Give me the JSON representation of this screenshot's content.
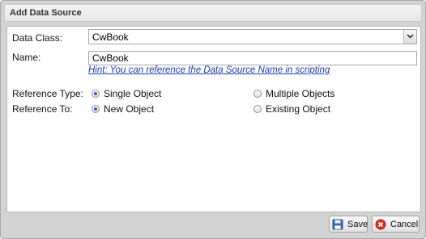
{
  "dialog": {
    "title": "Add Data Source",
    "data_class": {
      "label": "Data Class:",
      "value": "CwBook"
    },
    "name": {
      "label": "Name:",
      "value": "CwBook",
      "hint": "Hint: You can reference the Data Source Name in scripting"
    },
    "reference_type": {
      "label": "Reference Type:",
      "options": [
        {
          "label": "Single Object",
          "checked": true
        },
        {
          "label": "Multiple Objects",
          "checked": false
        }
      ]
    },
    "reference_to": {
      "label": "Reference To:",
      "options": [
        {
          "label": "New Object",
          "checked": true
        },
        {
          "label": "Existing Object",
          "checked": false
        }
      ]
    },
    "buttons": {
      "save": "Save",
      "cancel": "Cancel"
    }
  }
}
